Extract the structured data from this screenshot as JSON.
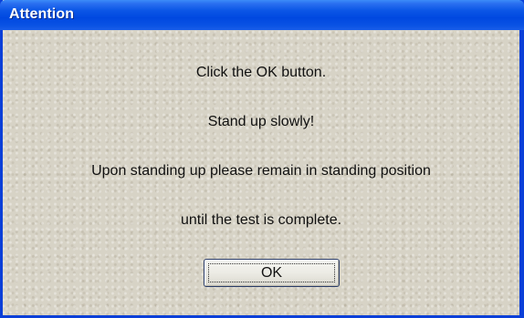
{
  "window": {
    "title": "Attention"
  },
  "message": {
    "line1": "Click the OK button.",
    "line2": "Stand up slowly!",
    "line3": "Upon standing up please remain in standing position",
    "line4": "until the test is complete."
  },
  "buttons": {
    "ok_label": "OK"
  },
  "colors": {
    "titlebar_blue": "#0048e0",
    "client_background": "#d7d3c6",
    "title_text": "#ffffff"
  }
}
